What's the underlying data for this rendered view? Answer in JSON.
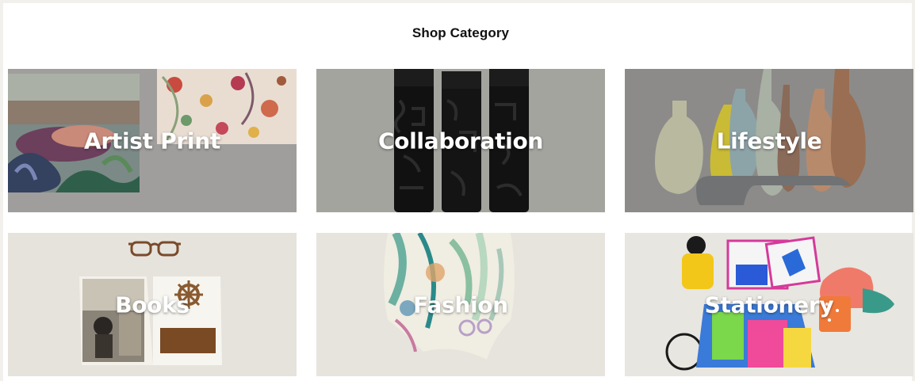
{
  "section": {
    "title": "Shop Category"
  },
  "categories": [
    {
      "label": "Artist Print",
      "image": "artist-print-image"
    },
    {
      "label": "Collaboration",
      "image": "collaboration-image"
    },
    {
      "label": "Lifestyle",
      "image": "lifestyle-image"
    },
    {
      "label": "Books",
      "image": "books-image"
    },
    {
      "label": "Fashion",
      "image": "fashion-image"
    },
    {
      "label": "Stationery",
      "image": "stationery-image"
    }
  ]
}
